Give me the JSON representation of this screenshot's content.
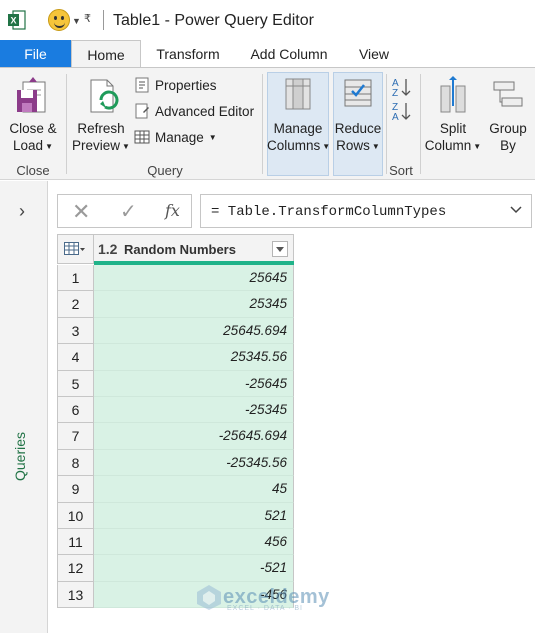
{
  "window": {
    "title": "Table1 - Power Query Editor"
  },
  "tabs": [
    "File",
    "Home",
    "Transform",
    "Add Column",
    "View"
  ],
  "ribbon": {
    "close_load": {
      "line1": "Close &",
      "line2": "Load"
    },
    "refresh_preview": {
      "line1": "Refresh",
      "line2": "Preview"
    },
    "properties": "Properties",
    "advanced_editor": "Advanced Editor",
    "manage": "Manage",
    "manage_columns": {
      "line1": "Manage",
      "line2": "Columns"
    },
    "reduce_rows": {
      "line1": "Reduce",
      "line2": "Rows"
    },
    "split_column": {
      "line1": "Split",
      "line2": "Column"
    },
    "group_by": {
      "line1": "Group",
      "line2": "By"
    },
    "groups": {
      "close": "Close",
      "query": "Query",
      "sort": "Sort"
    }
  },
  "side_panel": {
    "label": "Queries"
  },
  "formula_bar": {
    "formula": "= Table.TransformColumnTypes"
  },
  "grid": {
    "column": {
      "type": "1.2",
      "name": "Random Numbers"
    },
    "rows": [
      {
        "num": "1",
        "value": "25645"
      },
      {
        "num": "2",
        "value": "25345"
      },
      {
        "num": "3",
        "value": "25645.694"
      },
      {
        "num": "4",
        "value": "25345.56"
      },
      {
        "num": "5",
        "value": "-25645"
      },
      {
        "num": "6",
        "value": "-25345"
      },
      {
        "num": "7",
        "value": "-25645.694"
      },
      {
        "num": "8",
        "value": "-25345.56"
      },
      {
        "num": "9",
        "value": "45"
      },
      {
        "num": "10",
        "value": "521"
      },
      {
        "num": "11",
        "value": "456"
      },
      {
        "num": "12",
        "value": "-521"
      },
      {
        "num": "13",
        "value": "-456"
      }
    ]
  },
  "watermark": {
    "name": "exceldemy",
    "sub": "EXCEL · DATA · BI"
  },
  "colors": {
    "file_tab": "#1a7ce0",
    "cell_fill": "#d9f2e5",
    "header_accent": "#1fb389",
    "excel_green": "#217346"
  }
}
